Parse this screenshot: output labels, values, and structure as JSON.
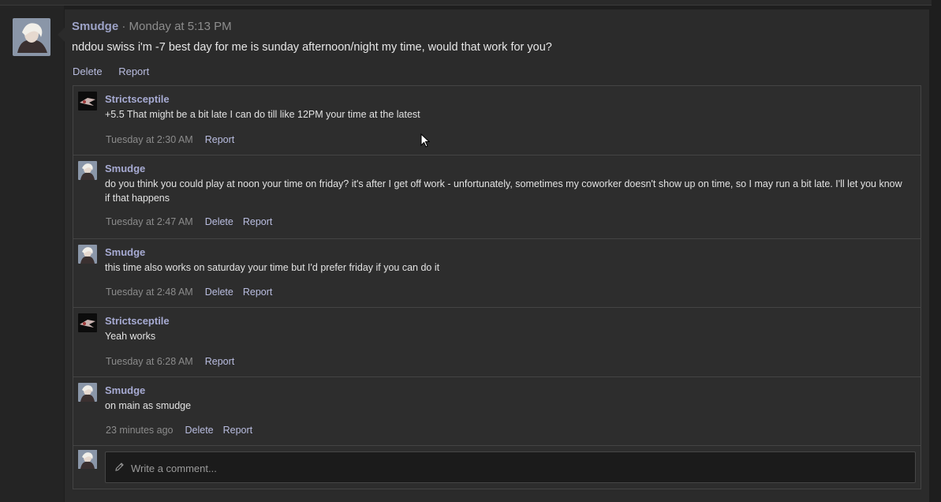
{
  "post": {
    "author": "Smudge",
    "separator": " · ",
    "timestamp": "Monday at 5:13 PM",
    "body": "nddou swiss i'm -7 best day for me is sunday afternoon/night my time, would that work for you?",
    "actions": {
      "delete": "Delete",
      "report": "Report"
    }
  },
  "comments": [
    {
      "author": "Strictsceptile",
      "text": "+5.5 That might be a bit late I can do till like 12PM your time at the latest",
      "time": "Tuesday at 2:30 AM",
      "report": "Report"
    },
    {
      "author": "Smudge",
      "text": "do you think you could play at noon your time on friday? it's after I get off work - unfortunately, sometimes my coworker doesn't show up on time, so I may run a bit late. I'll let you know if that happens",
      "time": "Tuesday at 2:47 AM",
      "delete": "Delete",
      "report": "Report"
    },
    {
      "author": "Smudge",
      "text": "this time also works on saturday your time but I'd prefer friday if you can do it",
      "time": "Tuesday at 2:48 AM",
      "delete": "Delete",
      "report": "Report"
    },
    {
      "author": "Strictsceptile",
      "text": "Yeah works",
      "time": "Tuesday at 6:28 AM",
      "report": "Report"
    },
    {
      "author": "Smudge",
      "text": "on main as smudge",
      "time": "23 minutes ago",
      "delete": "Delete",
      "report": "Report"
    }
  ],
  "composer": {
    "placeholder": "Write a comment..."
  },
  "icons": {
    "composer": "pencil-icon",
    "pointer": "mouse-cursor-icon"
  },
  "colors": {
    "author": "#a7abd3",
    "link": "#b9bde0",
    "background": "#1e1e1e"
  }
}
